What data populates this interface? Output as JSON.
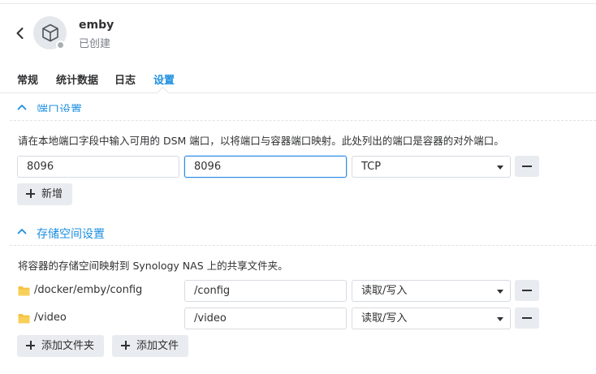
{
  "header": {
    "app_name": "emby",
    "status": "已创建"
  },
  "tabs": [
    {
      "label": "常规",
      "active": false
    },
    {
      "label": "统计数据",
      "active": false
    },
    {
      "label": "日志",
      "active": false
    },
    {
      "label": "设置",
      "active": true
    }
  ],
  "port_section": {
    "title": "端口设置",
    "description": "请在本地端口字段中输入可用的 DSM 端口，以将端口与容器端口映射。此处列出的端口是容器的对外端口。",
    "rows": [
      {
        "local_port": "8096",
        "container_port": "8096",
        "protocol": "TCP"
      }
    ],
    "add_label": "新增"
  },
  "storage_section": {
    "title": "存储空间设置",
    "description": "将容器的存储空间映射到 Synology NAS 上的共享文件夹。",
    "rows": [
      {
        "host_path": "/docker/emby/config",
        "mount_path": "/config",
        "mode": "读取/写入"
      },
      {
        "host_path": "/video",
        "mount_path": "/video",
        "mode": "读取/写入"
      }
    ],
    "add_folder_label": "添加文件夹",
    "add_file_label": "添加文件"
  },
  "colors": {
    "accent": "#1c8fe0",
    "folder": "#f5c242",
    "button_bg": "#e8ebef"
  },
  "icons": {
    "back": "chevron-left-icon",
    "app": "package-cube-icon",
    "collapse": "chevron-up-icon",
    "folder": "folder-icon",
    "add": "plus-icon",
    "remove": "minus-icon"
  }
}
